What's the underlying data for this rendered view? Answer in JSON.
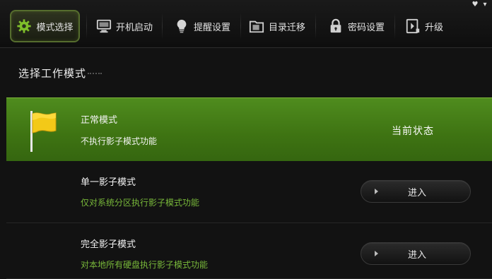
{
  "toolbar": {
    "tabs": [
      {
        "label": "模式选择",
        "icon": "gear-icon",
        "active": true
      },
      {
        "label": "开机启动",
        "icon": "computer-icon",
        "active": false
      },
      {
        "label": "提醒设置",
        "icon": "lightbulb-icon",
        "active": false
      },
      {
        "label": "目录迁移",
        "icon": "folder-icon",
        "active": false
      },
      {
        "label": "密码设置",
        "icon": "lock-icon",
        "active": false
      },
      {
        "label": "升级",
        "icon": "upgrade-icon",
        "active": false
      }
    ],
    "window_controls": [
      "♥",
      "▾"
    ]
  },
  "section": {
    "title": "选择工作模式"
  },
  "modes": [
    {
      "name": "正常模式",
      "description": "不执行影子模式功能",
      "status": "当前状态",
      "icon": "flag-icon"
    },
    {
      "name": "单一影子模式",
      "description": "仅对系统分区执行影子模式功能",
      "button_label": "进入"
    },
    {
      "name": "完全影子模式",
      "description": "对本地所有硬盘执行影子模式功能",
      "button_label": "进入"
    }
  ],
  "colors": {
    "accent_green": "#3e7312",
    "description_green": "#78b83a",
    "background": "#121212"
  }
}
